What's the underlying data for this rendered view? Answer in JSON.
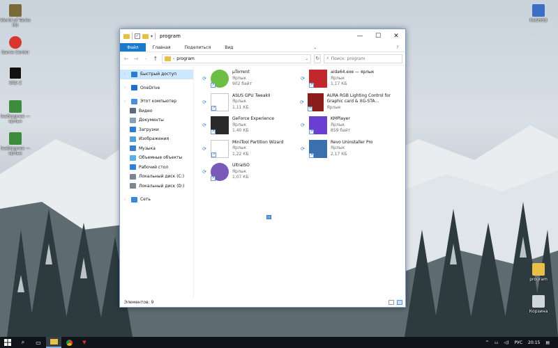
{
  "desktop": {
    "icons_left": [
      {
        "label": "World of Tanks RU",
        "icon": "tank-icon",
        "color": "#7a6a3a"
      },
      {
        "label": "Game Center",
        "icon": "game-center-icon",
        "color": "#d9362c"
      },
      {
        "label": "SSD Z",
        "icon": "ssd-icon",
        "color": "#111111"
      },
      {
        "label": "leaBrpgnee — ярлык",
        "icon": "app-shortcut-icon",
        "color": "#3c8c3c"
      },
      {
        "label": "leaBrpgnee — ярлык",
        "icon": "app-shortcut-icon",
        "color": "#3c8c3c"
      }
    ],
    "icons_right": [
      {
        "label": "RUSHRB",
        "icon": "app-icon",
        "color": "#3a6fc4"
      },
      {
        "label": "program",
        "icon": "folder-icon",
        "color": "#e8c048"
      },
      {
        "label": "Корзина",
        "icon": "recycle-bin-icon",
        "color": "#cfd6dc"
      }
    ]
  },
  "window": {
    "title": "program",
    "ribbon_tabs": [
      "Файл",
      "Главная",
      "Поделиться",
      "Вид"
    ],
    "address": {
      "path": "program"
    },
    "search": {
      "placeholder": "Поиск: program"
    },
    "nav_items": [
      {
        "label": "Быстрый доступ",
        "icon": "star-icon",
        "color": "#2b7cd3",
        "top": true,
        "selected": true
      },
      {
        "label": "OneDrive",
        "icon": "cloud-icon",
        "color": "#1f6fd1",
        "top": true
      },
      {
        "label": "Этот компьютер",
        "icon": "computer-icon",
        "color": "#4a90d9",
        "top": true
      },
      {
        "label": "Видео",
        "icon": "video-icon",
        "color": "#5a6b7a"
      },
      {
        "label": "Документы",
        "icon": "documents-icon",
        "color": "#8aa0b4"
      },
      {
        "label": "Загрузки",
        "icon": "downloads-icon",
        "color": "#2b7cd3"
      },
      {
        "label": "Изображения",
        "icon": "pictures-icon",
        "color": "#5aa0d8"
      },
      {
        "label": "Музыка",
        "icon": "music-icon",
        "color": "#3b7fcf"
      },
      {
        "label": "Объемные объекты",
        "icon": "3d-objects-icon",
        "color": "#5ab0e8"
      },
      {
        "label": "Рабочий стол",
        "icon": "desktop-icon",
        "color": "#2f82d8"
      },
      {
        "label": "Локальный диск (C:)",
        "icon": "drive-icon",
        "color": "#7a8793"
      },
      {
        "label": "Локальный диск (D:)",
        "icon": "drive-icon",
        "color": "#7a8793"
      },
      {
        "label": "Сеть",
        "icon": "network-icon",
        "color": "#3a86d8",
        "top": true
      }
    ],
    "files": [
      {
        "name": "µTorrent",
        "type": "Ярлык",
        "size": "902 байт",
        "icon": "utorrent-icon",
        "color": "#6cbe45"
      },
      {
        "name": "aida64.exe — ярлык",
        "type": "Ярлык",
        "size": "1,17 КБ",
        "icon": "aida64-icon",
        "color": "#c0282d"
      },
      {
        "name": "ASUS GPU TweakII",
        "type": "Ярлык",
        "size": "1,11 КБ",
        "icon": "blank-document-icon",
        "color": "#ffffff"
      },
      {
        "name": "AURA RGB Lighting Control for Graphic card & XG-STA...",
        "type": "Ярлык",
        "size": "",
        "icon": "aura-icon",
        "color": "#8a1c1c"
      },
      {
        "name": "GeForce Experience",
        "type": "Ярлык",
        "size": "1,40 КБ",
        "icon": "geforce-icon",
        "color": "#2a2a2a"
      },
      {
        "name": "KMPlayer",
        "type": "Ярлык",
        "size": "859 байт",
        "icon": "kmplayer-icon",
        "color": "#6b3fd1"
      },
      {
        "name": "MiniTool Partition Wizard",
        "type": "Ярлык",
        "size": "1,22 КБ",
        "icon": "blank-document-icon",
        "color": "#ffffff"
      },
      {
        "name": "Revo Uninstaller Pro",
        "type": "Ярлык",
        "size": "2,17 КБ",
        "icon": "revo-icon",
        "color": "#3a6fb0"
      },
      {
        "name": "UltraISO",
        "type": "Ярлык",
        "size": "1,07 КБ",
        "icon": "ultraiso-icon",
        "color": "#7a5ab8"
      }
    ],
    "status": "Элементов: 9"
  },
  "taskbar": {
    "language": "РУС",
    "time": "20:15"
  }
}
